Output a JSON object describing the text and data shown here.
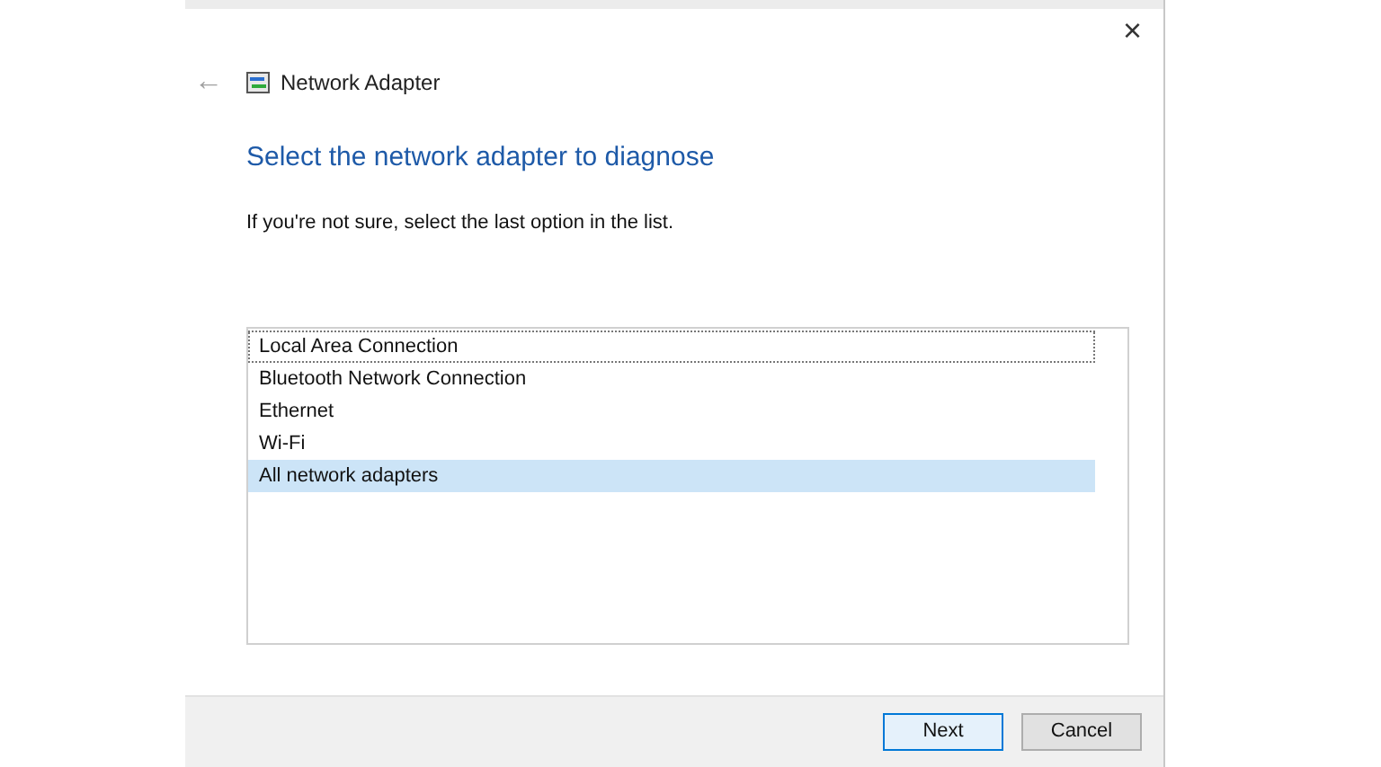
{
  "window": {
    "title": "Network Adapter",
    "close": "×",
    "back": "←"
  },
  "heading": "Select the network adapter to diagnose",
  "instruction": "If you're not sure, select the last option in the list.",
  "adapters": [
    {
      "label": "Local Area Connection",
      "selected": false,
      "focused": true
    },
    {
      "label": "Bluetooth Network Connection",
      "selected": false,
      "focused": false
    },
    {
      "label": "Ethernet",
      "selected": false,
      "focused": false
    },
    {
      "label": "Wi-Fi",
      "selected": false,
      "focused": false
    },
    {
      "label": "All network adapters",
      "selected": true,
      "focused": false
    }
  ],
  "buttons": [
    {
      "label": "Next",
      "kind": "default"
    },
    {
      "label": "Cancel",
      "kind": "normal"
    }
  ]
}
